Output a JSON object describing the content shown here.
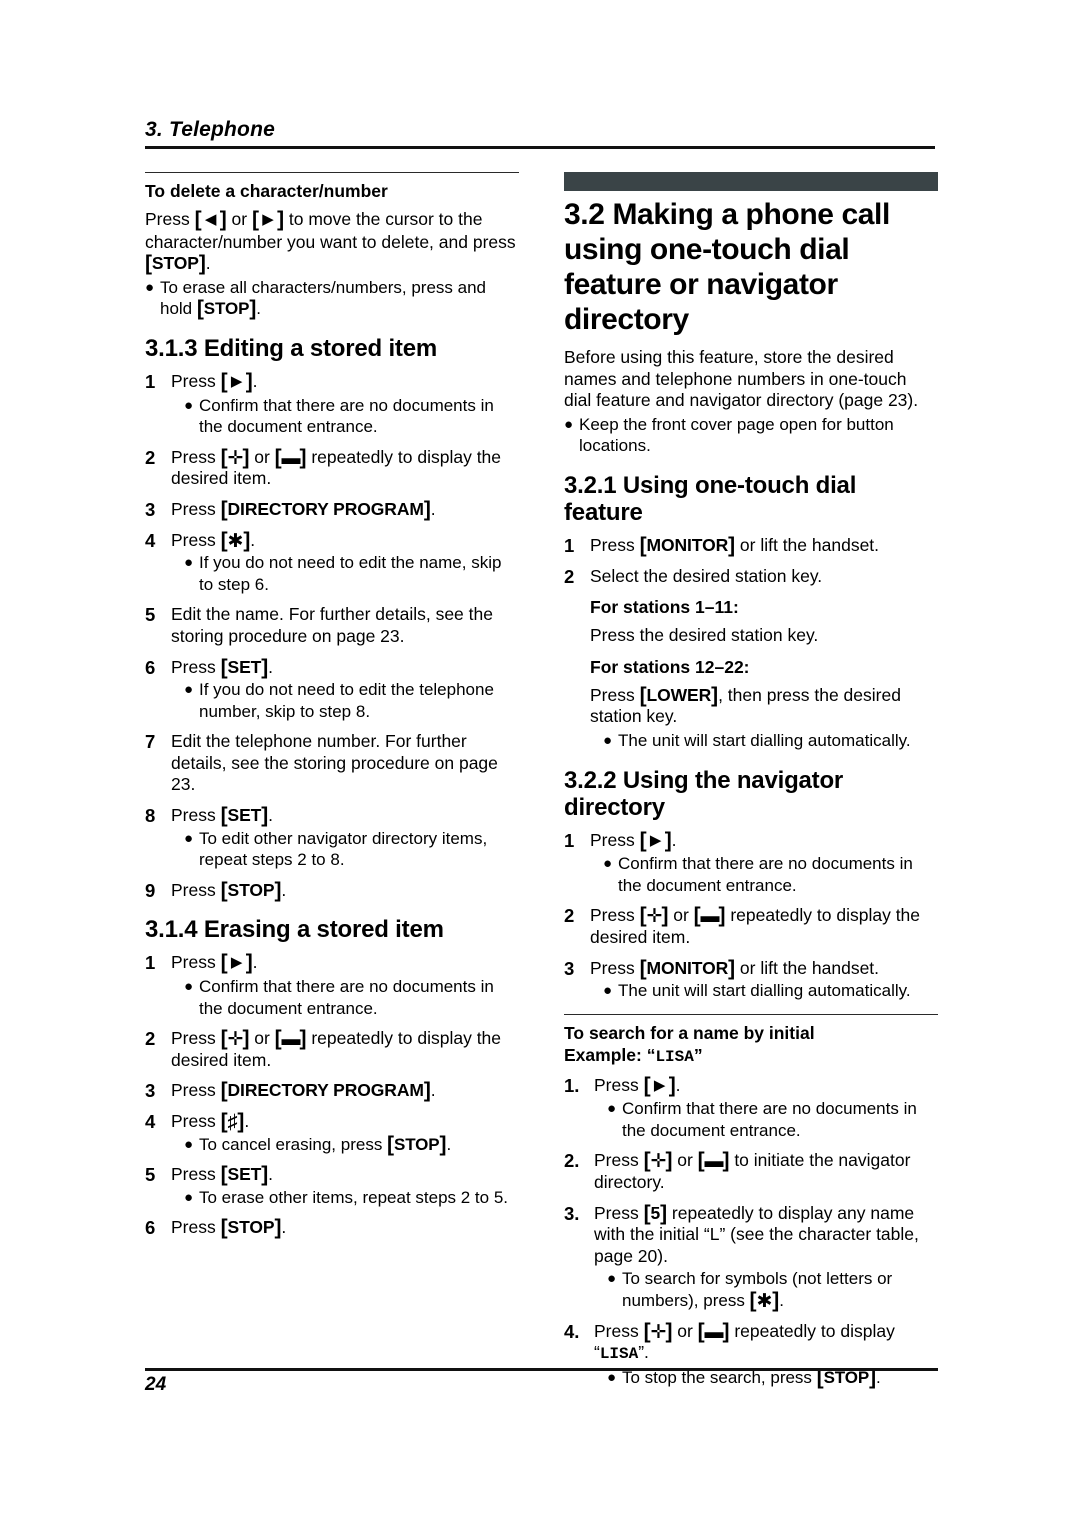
{
  "running_head": {
    "chapter": "3. Telephone"
  },
  "footer": {
    "page_number": "24"
  },
  "glyphs": {
    "left_arrow": "◀",
    "right_arrow": "▶",
    "plus": "✛",
    "minus": "▬",
    "star": "✱",
    "sharp": "♯",
    "bracket_open": "[",
    "bracket_close": "]",
    "bullet": "●"
  },
  "colors": {
    "heading_bar": "#3a4447",
    "rule": "#111111",
    "text": "#000000"
  },
  "left_column": {
    "delete_block": {
      "heading": "To delete a character/number",
      "body_pre": "Press ",
      "body_mid": " or ",
      "body_post": " to move the cursor to the character/number you want to delete, and press ",
      "key_stop": "STOP",
      "body_end": ".",
      "bullet_pre": "To erase all characters/numbers, press and hold ",
      "bullet_key": "STOP",
      "bullet_end": "."
    },
    "section_313": {
      "heading": "3.1.3 Editing a stored item",
      "steps": [
        {
          "num": "1",
          "text_pre": "Press ",
          "glyph": "right_arrow",
          "text_post": ".",
          "bullets": [
            "Confirm that there are no documents in the document entrance."
          ]
        },
        {
          "num": "2",
          "text_pre": "Press ",
          "glyph": "plus",
          "text_mid": " or ",
          "glyph2": "minus",
          "text_post": " repeatedly to display the desired item.",
          "bullets": []
        },
        {
          "num": "3",
          "text_pre": "Press ",
          "key": "DIRECTORY PROGRAM",
          "text_post": ".",
          "bullets": []
        },
        {
          "num": "4",
          "text_pre": "Press ",
          "glyph": "star",
          "text_post": ".",
          "bullets": [
            "If you do not need to edit the name, skip to step 6."
          ]
        },
        {
          "num": "5",
          "plain": "Edit the name. For further details, see the storing procedure on page 23.",
          "bullets": []
        },
        {
          "num": "6",
          "text_pre": "Press ",
          "key": "SET",
          "text_post": ".",
          "bullets": [
            "If you do not need to edit the telephone number, skip to step 8."
          ]
        },
        {
          "num": "7",
          "plain": "Edit the telephone number. For further details, see the storing procedure on page 23.",
          "bullets": []
        },
        {
          "num": "8",
          "text_pre": "Press ",
          "key": "SET",
          "text_post": ".",
          "bullets": [
            "To edit other navigator directory items, repeat steps 2 to 8."
          ]
        },
        {
          "num": "9",
          "text_pre": "Press ",
          "key": "STOP",
          "text_post": ".",
          "bullets": []
        }
      ]
    },
    "section_314": {
      "heading": "3.1.4 Erasing a stored item",
      "steps": [
        {
          "num": "1",
          "text_pre": "Press ",
          "glyph": "right_arrow",
          "text_post": ".",
          "bullets": [
            "Confirm that there are no documents in the document entrance."
          ]
        },
        {
          "num": "2",
          "text_pre": "Press ",
          "glyph": "plus",
          "text_mid": " or ",
          "glyph2": "minus",
          "text_post": " repeatedly to display the desired item.",
          "bullets": []
        },
        {
          "num": "3",
          "text_pre": "Press ",
          "key": "DIRECTORY PROGRAM",
          "text_post": ".",
          "bullets": []
        },
        {
          "num": "4",
          "text_pre": "Press ",
          "glyph": "sharp",
          "text_post": ".",
          "bullets_rich": [
            {
              "pre": "To cancel erasing, press ",
              "key": "STOP",
              "post": "."
            }
          ]
        },
        {
          "num": "5",
          "text_pre": "Press ",
          "key": "SET",
          "text_post": ".",
          "bullets": [
            "To erase other items, repeat steps 2 to 5."
          ]
        },
        {
          "num": "6",
          "text_pre": "Press ",
          "key": "STOP",
          "text_post": ".",
          "bullets": []
        }
      ]
    }
  },
  "right_column": {
    "section_32": {
      "heading": "3.2 Making a phone call using one-touch dial feature or navigator directory",
      "intro": "Before using this feature, store the desired names and telephone numbers in one-touch dial feature and navigator directory (page 23).",
      "intro_bullet": "Keep the front cover page open for button locations."
    },
    "section_321": {
      "heading": "3.2.1 Using one-touch dial feature",
      "step1_pre": "Press ",
      "step1_key": "MONITOR",
      "step1_post": " or lift the handset.",
      "step2": "Select the desired station key.",
      "stations_a_head": "For stations 1–11:",
      "stations_a_body": "Press the desired station key.",
      "stations_b_head": "For stations 12–22:",
      "stations_b_pre": "Press ",
      "stations_b_key": "LOWER",
      "stations_b_post": ", then press the desired station key.",
      "final_bullet": "The unit will start dialling automatically."
    },
    "section_322": {
      "heading": "3.2.2 Using the navigator directory",
      "steps": [
        {
          "num": "1",
          "text_pre": "Press ",
          "glyph": "right_arrow",
          "text_post": ".",
          "bullets": [
            "Confirm that there are no documents in the document entrance."
          ]
        },
        {
          "num": "2",
          "text_pre": "Press ",
          "glyph": "plus",
          "text_mid": " or ",
          "glyph2": "minus",
          "text_post": " repeatedly to display the desired item.",
          "bullets": []
        },
        {
          "num": "3",
          "text_pre": "Press ",
          "key": "MONITOR",
          "text_post": " or lift the handset.",
          "bullets": [
            "The unit will start dialling automatically."
          ]
        }
      ]
    },
    "search_block": {
      "heading": "To search for a name by initial",
      "example_label": "Example: ",
      "example_open_quote": "“",
      "example_name": "LISA",
      "example_close_quote": "”",
      "steps": [
        {
          "num": "1.",
          "text_pre": "Press ",
          "glyph": "right_arrow",
          "text_post": ".",
          "bullets": [
            "Confirm that there are no documents in the document entrance."
          ]
        },
        {
          "num": "2.",
          "text_pre": "Press ",
          "glyph": "plus",
          "text_mid": " or ",
          "glyph2": "minus",
          "text_post": " to initiate the navigator directory.",
          "bullets": []
        },
        {
          "num": "3.",
          "text_pre": "Press ",
          "key": "5",
          "text_post": " repeatedly to display any name with the initial “L” (see the character table, page 20).",
          "bullets_rich": [
            {
              "pre": "To search for symbols (not letters or numbers), press ",
              "glyph": "star",
              "post": "."
            }
          ]
        },
        {
          "num": "4.",
          "text_pre": "Press ",
          "glyph": "plus",
          "text_mid": " or ",
          "glyph2": "minus",
          "text_post": " repeatedly to display “LISA”.",
          "bullets_rich": [
            {
              "pre": "To stop the search, press ",
              "key": "STOP",
              "post": "."
            }
          ]
        }
      ]
    }
  }
}
